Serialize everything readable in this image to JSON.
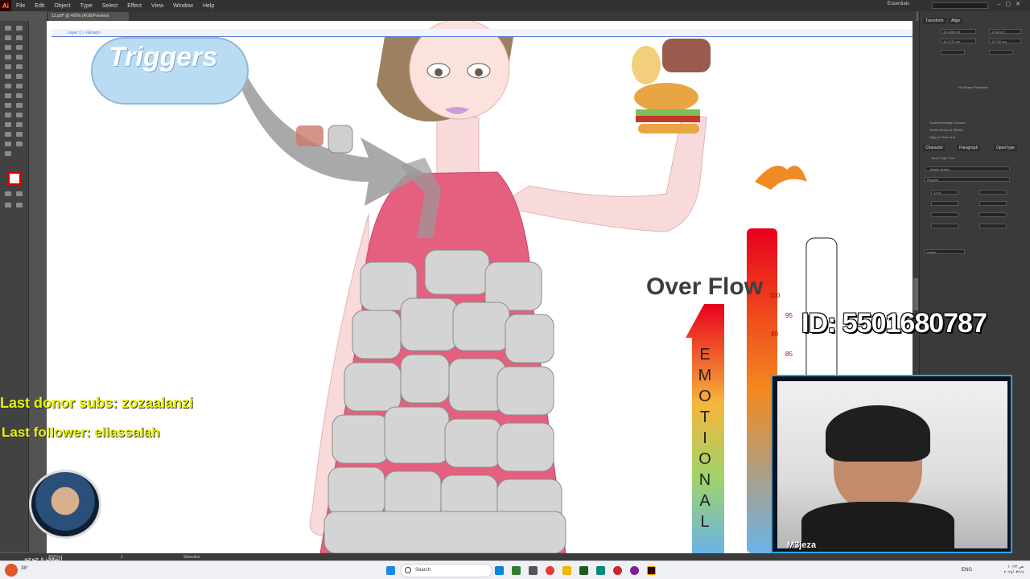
{
  "app": {
    "logo": "Ai",
    "workspace": "Essentials"
  },
  "menu": [
    "File",
    "Edit",
    "Object",
    "Type",
    "Select",
    "Effect",
    "View",
    "Window",
    "Help"
  ],
  "document_tab": "12.pdf* @ 400% (RGB/Preview)",
  "layer_path": "Layer 1 ⟩ <Group>",
  "panels": {
    "transform_tabs": [
      "Transform",
      "Align"
    ],
    "x_value": "18.3495 cm",
    "w_value": "1.638 cm",
    "y_value": "16.7475 cm",
    "h_value": "10.752 cm",
    "no_shape": "No Shape Properties",
    "checks": [
      "Scale Rectangle Corners",
      "Scale Strokes & Effects",
      "Align to Pixel Grid"
    ],
    "char_tabs": [
      "Character",
      "Paragraph",
      "OpenType"
    ],
    "touch_type": "Touch Type Tool",
    "font_family": "Adobe Arabic",
    "font_style": "Regular",
    "font_size": "12 pt",
    "lang": "Arabic"
  },
  "status": {
    "zoom": "400%",
    "page": "1",
    "tool": "Selection"
  },
  "illustration": {
    "cloud_text": "Triggers",
    "overflow_text": "Over Flow",
    "emotional_letters": [
      "E",
      "M",
      "O",
      "T",
      "I",
      "O",
      "N",
      "A",
      "L"
    ],
    "scale_ticks": [
      "100",
      "95",
      "90",
      "85"
    ],
    "bar_fill_fraction": 1.0
  },
  "stream": {
    "donor_text": "Last donor subs: zozaalanzi",
    "follower_text": "Last follower: eliassalah",
    "id_text": "ID: 5501680787",
    "cam_name": "M3jeza",
    "avatar_caption": "المعجزة جوجه"
  },
  "taskbar": {
    "search": "Search",
    "lang": "ENG",
    "time": "۱۰:۲۲ ص",
    "date": "٢٠٢٤/٠٣/١٩",
    "temp": "38°"
  },
  "colors": {
    "ui_dark": "#323232",
    "panel": "#3a3a3a",
    "overlay_yellow": "#e8f000",
    "accent_blue": "#2ba6e5"
  }
}
